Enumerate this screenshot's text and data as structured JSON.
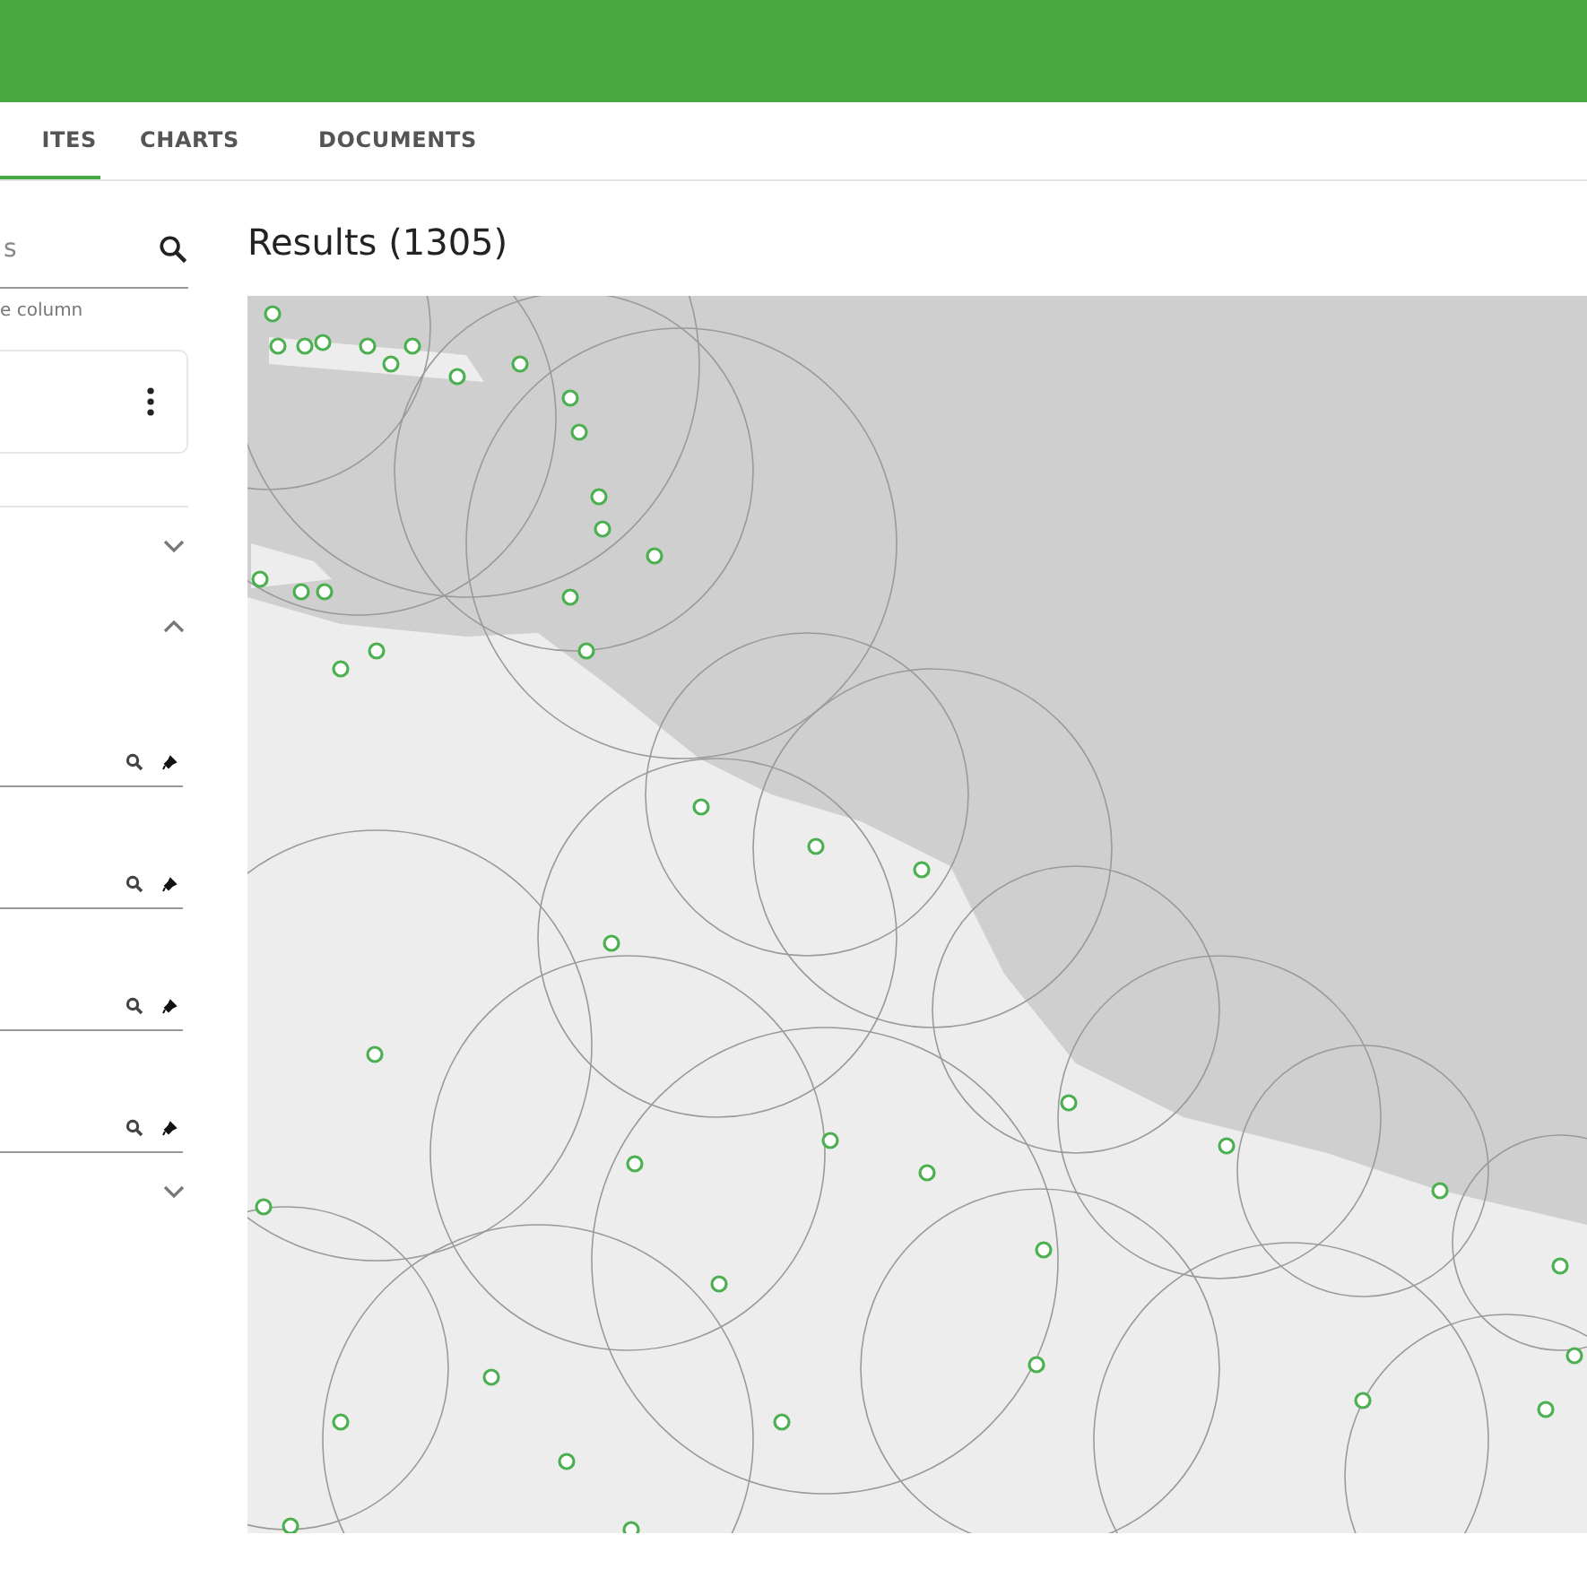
{
  "tabs": [
    {
      "label": "ITES",
      "selected": true
    },
    {
      "label": "CHARTS",
      "selected": false
    },
    {
      "label": "DOCUMENTS",
      "selected": false
    }
  ],
  "search": {
    "placeholder": "s"
  },
  "hint": "e column",
  "sections": [
    {
      "expanded": false
    },
    {
      "expanded": true,
      "filter_fields": [
        {
          "pinned": true
        },
        {
          "pinned": true
        },
        {
          "pinned": true
        },
        {
          "pinned": true
        }
      ]
    },
    {
      "expanded": false
    }
  ],
  "results": {
    "title": "Results (1305)"
  }
}
